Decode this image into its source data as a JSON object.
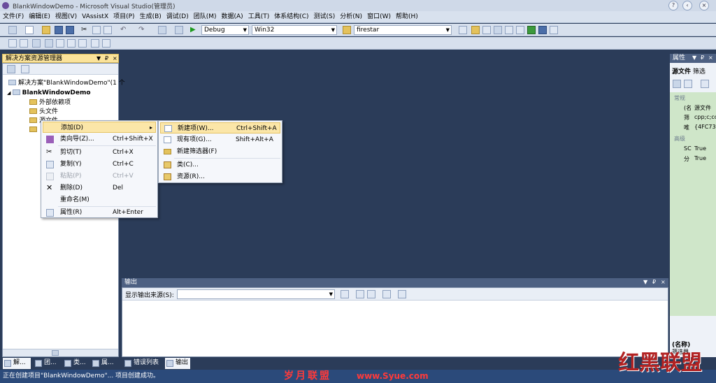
{
  "window": {
    "title": "BlankWindowDemo - Microsoft Visual Studio(管理员)",
    "help_btn": "?",
    "minimize_btn": "‹",
    "close_btn": "×"
  },
  "menubar": [
    "文件(F)",
    "编辑(E)",
    "视图(V)",
    "VAssistX",
    "项目(P)",
    "生成(B)",
    "调试(D)",
    "团队(M)",
    "数据(A)",
    "工具(T)",
    "体系结构(C)",
    "测试(S)",
    "分析(N)",
    "窗口(W)",
    "帮助(H)"
  ],
  "toolbar": {
    "config": "Debug",
    "platform": "Win32",
    "find": "firestar"
  },
  "solution_explorer": {
    "title": "解决方案资源管理器",
    "pin": "₽",
    "close": "×",
    "solution": "解决方案\"BlankWindowDemo\"(1 个",
    "project": "BlankWindowDemo",
    "items": [
      "外部依赖项",
      "头文件",
      "源文件"
    ]
  },
  "context_menu": {
    "items": [
      {
        "label": "添加(D)",
        "shortcut": "",
        "arrow": "▸"
      },
      {
        "label": "类向导(Z)...",
        "shortcut": "Ctrl+Shift+X"
      },
      {
        "label": "剪切(T)",
        "shortcut": "Ctrl+X"
      },
      {
        "label": "复制(Y)",
        "shortcut": "Ctrl+C"
      },
      {
        "label": "粘贴(P)",
        "shortcut": "Ctrl+V"
      },
      {
        "label": "删除(D)",
        "shortcut": "Del"
      },
      {
        "label": "重命名(M)",
        "shortcut": ""
      },
      {
        "label": "属性(R)",
        "shortcut": "Alt+Enter"
      }
    ]
  },
  "submenu": {
    "items": [
      {
        "label": "新建项(W)...",
        "shortcut": "Ctrl+Shift+A"
      },
      {
        "label": "现有项(G)...",
        "shortcut": "Shift+Alt+A"
      },
      {
        "label": "新建筛选器(F)",
        "shortcut": ""
      },
      {
        "label": "类(C)...",
        "shortcut": ""
      },
      {
        "label": "资源(R)...",
        "shortcut": ""
      }
    ]
  },
  "output": {
    "title": "输出",
    "source_label": "显示输出来源(S):"
  },
  "properties": {
    "title": "属性",
    "object": "源文件",
    "filter": "筛选",
    "sections": [
      "常规",
      "高级"
    ],
    "rows": [
      {
        "k": "(名",
        "v": "源文件"
      },
      {
        "k": "筛",
        "v": "cpp;c;cc"
      },
      {
        "k": "唯",
        "v": "{4FC737"
      },
      {
        "k": "SC",
        "v": "True"
      },
      {
        "k": "分",
        "v": "True"
      }
    ],
    "footer_name": "(名称)",
    "footer_desc": "筛选器"
  },
  "bottom_tabs": [
    "解...",
    "团...",
    "类...",
    "属...",
    "错误列表",
    "输出"
  ],
  "status": "正在创建项目\"BlankWindowDemo\"... 项目创建成功。",
  "watermarks": {
    "cn": "岁月联盟",
    "url": "www.Syue.com",
    "logo": "红黑联盟"
  }
}
